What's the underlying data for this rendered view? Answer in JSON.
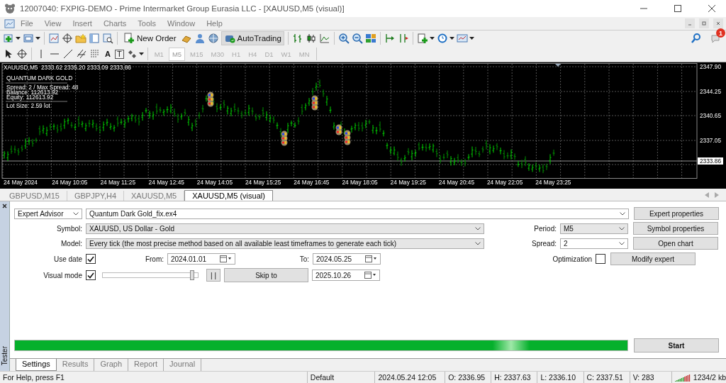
{
  "window": {
    "title": "12007040: FXPIG-DEMO - Prime Intermarket Group Eurasia LLC - [XAUUSD,M5 (visual)]"
  },
  "menu": [
    "File",
    "View",
    "Insert",
    "Charts",
    "Tools",
    "Window",
    "Help"
  ],
  "toolbar": {
    "new_order": "New Order",
    "autotrading": "AutoTrading",
    "notification_count": "1"
  },
  "drawing_toolbar": {
    "text_glyph": "A",
    "label_glyph": "T"
  },
  "timeframes": [
    {
      "label": "M1",
      "selected": false
    },
    {
      "label": "M5",
      "selected": true
    },
    {
      "label": "M15",
      "selected": false
    },
    {
      "label": "M30",
      "selected": false
    },
    {
      "label": "H1",
      "selected": false
    },
    {
      "label": "H4",
      "selected": false
    },
    {
      "label": "D1",
      "selected": false
    },
    {
      "label": "W1",
      "selected": false
    },
    {
      "label": "MN",
      "selected": false
    }
  ],
  "chart": {
    "symbol": "XAUUSD,M5",
    "ohlc": "2333.62 2335.20 2333.09 2333.86",
    "overlay": {
      "title": "QUANTUM DARK GOLD",
      "spread": "Spread:  2 / Max Spread: 48",
      "balance": "Balance:  112613.92",
      "equity": "Equity:   112613.92",
      "lot_size": "Lot Size:  2.59 lot"
    },
    "price_labels": [
      "2347.90",
      "2344.25",
      "2340.65",
      "2337.05"
    ],
    "current_price": "2333.86",
    "time_labels": [
      "24 May 2024",
      "24 May 10:05",
      "24 May 11:25",
      "24 May 12:45",
      "24 May 14:05",
      "24 May 15:25",
      "24 May 16:45",
      "24 May 18:05",
      "24 May 19:25",
      "24 May 20:45",
      "24 May 22:05",
      "24 May 23:25"
    ]
  },
  "chart_tabs": [
    {
      "label": "GBPUSD,M15",
      "selected": false
    },
    {
      "label": "GBPJPY,H4",
      "selected": false
    },
    {
      "label": "XAUUSD,M5",
      "selected": false
    },
    {
      "label": "XAUUSD,M5 (visual)",
      "selected": true
    }
  ],
  "tester": {
    "side_label": "Tester",
    "mode": "Expert Advisor",
    "expert": "Quantum Dark Gold_fix.ex4",
    "symbol_label": "Symbol:",
    "symbol": "XAUUSD, US Dollar - Gold",
    "model_label": "Model:",
    "model": "Every tick (the most precise method based on all available least timeframes to generate each tick)",
    "period_label": "Period:",
    "period": "M5",
    "spread_label": "Spread:",
    "spread": "2",
    "use_date": {
      "label": "Use date",
      "checked": true
    },
    "from_label": "From:",
    "from": "2024.01.01",
    "to_label": "To:",
    "to": "2024.05.25",
    "visual_mode": {
      "label": "Visual mode",
      "checked": true
    },
    "speed": {
      "level": 0.97
    },
    "pause": "| |",
    "skip_to": "Skip to",
    "skip_date": "2025.10.26",
    "optimization": {
      "label": "Optimization",
      "checked": false
    },
    "buttons": [
      "Expert properties",
      "Symbol properties",
      "Open chart",
      "Modify expert"
    ],
    "progress": {
      "level": 1
    },
    "start": "Start",
    "tabs": [
      {
        "label": "Settings",
        "selected": true
      },
      {
        "label": "Results",
        "selected": false
      },
      {
        "label": "Graph",
        "selected": false
      },
      {
        "label": "Report",
        "selected": false
      },
      {
        "label": "Journal",
        "selected": false
      }
    ]
  },
  "status_bar": {
    "help": "For Help, press F1",
    "profile": "Default",
    "time": "2024.05.24 12:05",
    "open": "O: 2336.95",
    "high": "H: 2337.63",
    "low": "L: 2336.10",
    "close": "C: 2337.51",
    "volume": "V: 283",
    "traffic": "1234/2 kb"
  }
}
